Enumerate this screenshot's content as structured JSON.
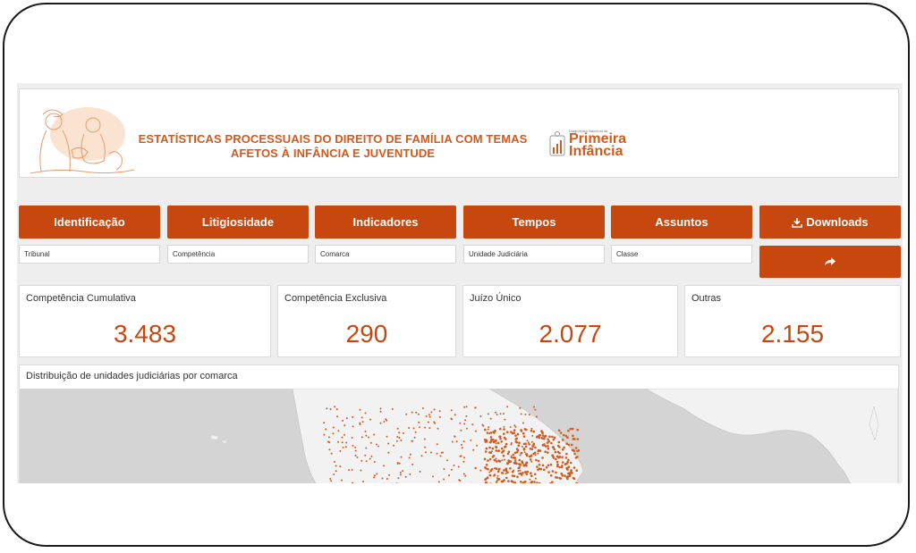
{
  "banner": {
    "title_line1": "ESTATÍSTICAS PROCESSUAIS DO DIREITO DE FAMÍLIA COM TEMAS",
    "title_line2": "AFETOS À INFÂNCIA E JUVENTUDE",
    "logo_small": "Diagnóstico Nacional da",
    "logo_line1": "Primeira",
    "logo_line2": "Infância"
  },
  "nav": [
    {
      "label": "Identificação"
    },
    {
      "label": "Litigiosidade"
    },
    {
      "label": "Indicadores"
    },
    {
      "label": "Tempos"
    },
    {
      "label": "Assuntos"
    },
    {
      "label": "Downloads",
      "icon": "download-icon"
    }
  ],
  "filters": [
    {
      "placeholder": "Tribunal"
    },
    {
      "placeholder": "Competência"
    },
    {
      "placeholder": "Comarca"
    },
    {
      "placeholder": "Unidade Judiciária"
    },
    {
      "placeholder": "Classe"
    }
  ],
  "share_button": {
    "icon": "share-icon"
  },
  "kpis": [
    {
      "label": "Competência Cumulativa",
      "value": "3.483"
    },
    {
      "label": "Competência Exclusiva",
      "value": "290"
    },
    {
      "label": "Juízo Único",
      "value": "2.077"
    },
    {
      "label": "Outras",
      "value": "2.155"
    }
  ],
  "map_panel": {
    "title": "Distribuição de unidades judiciárias por comarca"
  },
  "colors": {
    "accent": "#c8470e",
    "title": "#d25a1c",
    "map_land": "#f2f2f2",
    "map_water": "#d4d4d4"
  }
}
